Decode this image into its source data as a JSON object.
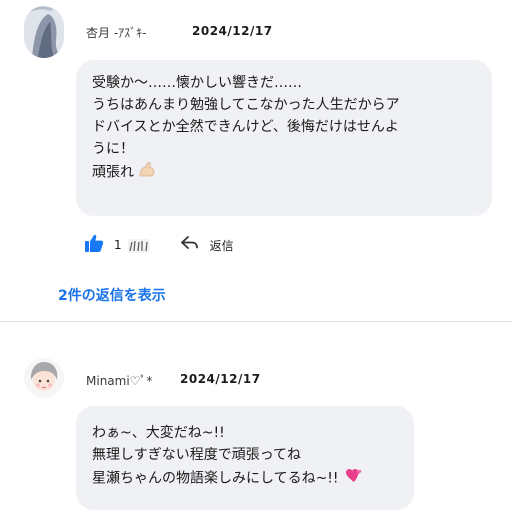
{
  "comments": [
    {
      "user": {
        "name": "杏月 -ｱｽﾞｷ-"
      },
      "date": "2024/12/17",
      "body": {
        "lines": [
          "受験か〜……懐かしい響きだ……",
          "うちはあんまり勉強してこなかった人生だからア",
          "ドバイスとか全然できんけど、後悔だけはせんよ",
          "うに！",
          "頑張れ"
        ],
        "trailing_emoji_icon": "flexed-biceps-emoji"
      },
      "actions": {
        "like_icon": "thumbs-up-icon",
        "like_count": "1",
        "reply_icon": "reply-arrow-icon",
        "reply_label": "返信"
      },
      "replies_link": "2件の返信を表示"
    },
    {
      "user": {
        "name": "Minami♡ﾟ*"
      },
      "date": "2024/12/17",
      "body": {
        "lines": [
          "わぁ~、大変だね~!!",
          "無理しすぎない程度で頑張ってね",
          "星瀬ちゃんの物語楽しみにしてるね~!!"
        ],
        "trailing_emoji_icon": "two-hearts-emoji"
      }
    }
  ],
  "colors": {
    "accent_link": "#1a73e8",
    "like_icon": "#1877f2",
    "bubble_bg": "#f0f1f4",
    "divider": "#e3e3e6"
  }
}
